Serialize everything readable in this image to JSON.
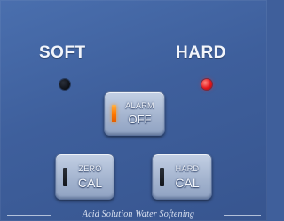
{
  "modes": {
    "soft_label": "SOFT",
    "hard_label": "HARD"
  },
  "indicators": {
    "soft_led": {
      "state": "off",
      "color": "#0c0f16"
    },
    "hard_led": {
      "state": "on",
      "color": "#e5161b"
    }
  },
  "buttons": {
    "alarm_off": {
      "line1": "ALARM",
      "line2": "OFF",
      "indicator": "on",
      "indicator_color": "#ff7a00"
    },
    "zero_cal": {
      "line1": "ZERO",
      "line2": "CAL",
      "indicator": "off"
    },
    "hard_cal": {
      "line1": "HARD",
      "line2": "CAL",
      "indicator": "off"
    }
  },
  "footer": {
    "text": "Acid Solution Water Softening"
  },
  "colors": {
    "panel": "#3f5f9b",
    "button_face": "#a4b4cf"
  }
}
